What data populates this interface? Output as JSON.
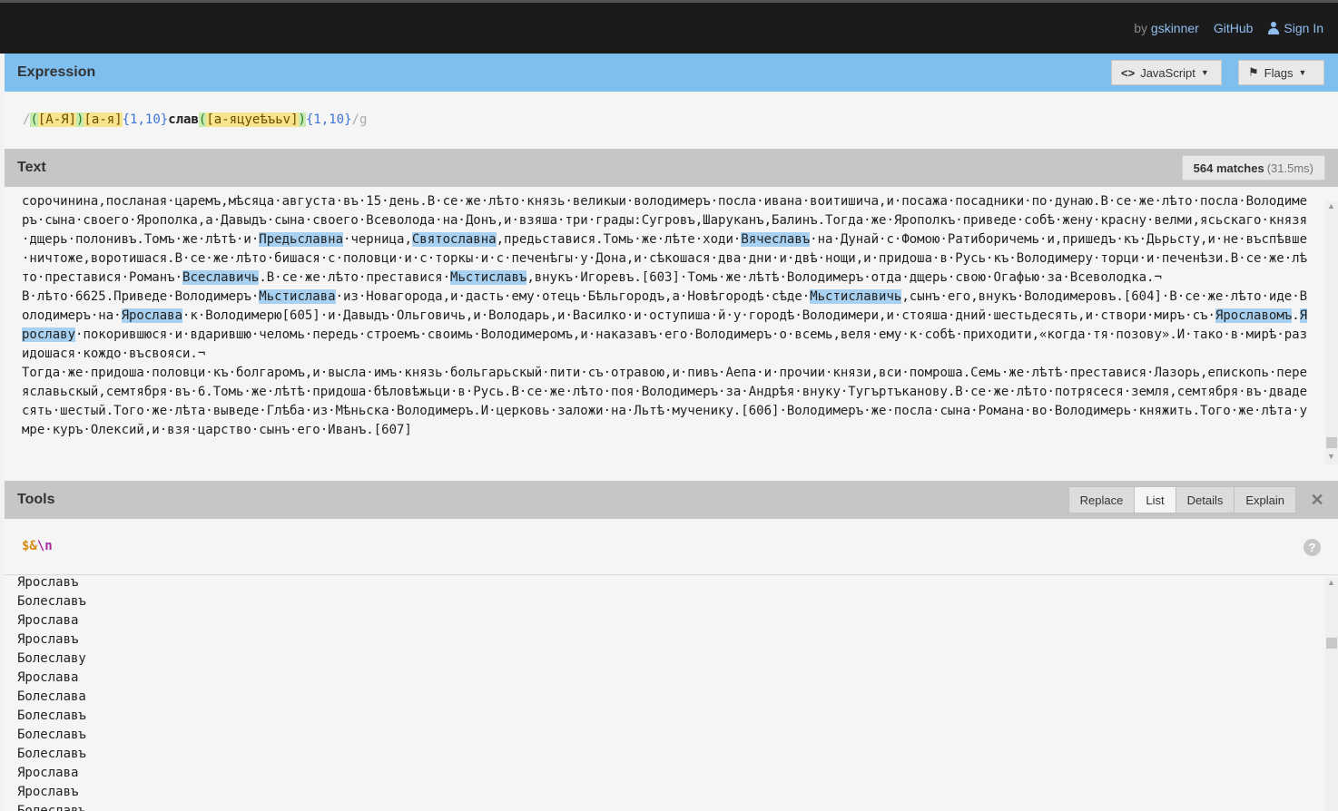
{
  "topbar": {
    "by_prefix": "by",
    "author": "gskinner",
    "github": "GitHub",
    "signin": "Sign In"
  },
  "expression": {
    "header": "Expression",
    "flavor": "JavaScript",
    "flags_label": "Flags",
    "tokens": {
      "open_slash": "/",
      "group_open": "(",
      "set1": "[А-Я]",
      "group_close": ")",
      "set2": "[а-я]",
      "quant1": "{1,10}",
      "literal": "слав",
      "group2_open": "(",
      "set3": "[а-яцуеѣъьv]",
      "group2_close": ")",
      "quant2": "{1,10}",
      "close_slash": "/",
      "flags": "g"
    }
  },
  "text_panel": {
    "header": "Text",
    "match_count": "564 matches",
    "match_time": "(31.5ms)",
    "segments": [
      {
        "t": "сорочинина,посланая·царемъ,мѣсяца·августа·въ·15·день.В·се·же·лѣто·князь·великыи·володимеръ·посла·ивана·воитишича,и·посажа·посадники·по·дунаю.В·се·же·лѣто·посла·Володимеръ·сына·своего·Ярополка,а·Давыдъ·сына·своего·Всеволода·на·Донъ,и·взяша·три·грады:Сугровъ,Шаруканъ,Балинъ.Тогда·же·Ярополкъ·приведе·собѣ·жену·красну·велми,ясьскаго·князя·дщерь·полонивъ.Томъ·же·лѣтѣ·и·"
      },
      {
        "t": "Предьславна",
        "h": true
      },
      {
        "t": "·черница,"
      },
      {
        "t": "Святославна",
        "h": true
      },
      {
        "t": ",предьставися.Томь·же·лѣте·ходи·"
      },
      {
        "t": "Вячеславъ",
        "h": true
      },
      {
        "t": "·на·Дунай·с·Фомою·Ратиборичемь·и,пришедъ·къ·Дьрьсту,и·не·въспѣвше·ничтоже,воротишася.В·се·же·лѣто·бишася·с·половци·и·с·торкы·и·с·печенѣгы·у·Дона,и·сѣкошася·два·дни·и·двѣ·нощи,и·придоша·в·Русь·къ·Володимеру·торци·и·печенѣзи.В·се·же·лѣто·преставися·Романъ·"
      },
      {
        "t": "Всеславичь",
        "h": true
      },
      {
        "t": ".В·се·же·лѣто·преставися·"
      },
      {
        "t": "Мьстиславъ",
        "h": true
      },
      {
        "t": ",внукъ·Игоревъ.[603]·Томь·же·лѣтѣ·Володимеръ·отда·дщерь·свою·Огафью·за·Всеволодка.¬\nВ·лѣто·6625.Приведе·Володимеръ·"
      },
      {
        "t": "Мьстислава",
        "h": true
      },
      {
        "t": "·из·Новагорода,и·дасть·ему·отець·Бѣльгородъ,а·Новѣгородѣ·сѣде·"
      },
      {
        "t": "Мьстиславичь",
        "h": true
      },
      {
        "t": ",сынъ·его,внукъ·Володимеровъ.[604]·В·се·же·лѣто·иде·Володимеръ·на·"
      },
      {
        "t": "Ярослава",
        "h": true
      },
      {
        "t": "·к·Володимерю[605]·и·Давыдъ·Ольговичь,и·Володарь,и·Василко·и·оступиша·й·у·городѣ·Володимери,и·стояша·дний·шестьдесять,и·створи·миръ·съ·"
      },
      {
        "t": "Ярославомъ",
        "h": true
      },
      {
        "t": "."
      },
      {
        "t": "Ярославу",
        "h": true
      },
      {
        "t": "·покорившюся·и·вдарившю·челомь·передь·строемъ·своимь·Володимеромъ,и·наказавъ·его·Володимеръ·о·всемь,веля·ему·к·собѣ·приходити,«когда·тя·позову».И·тако·в·мирѣ·разидошася·кождо·въсвояси.¬\nТогда·же·придоша·половци·къ·болгаромъ,и·высла·имъ·князь·больгарьскый·пити·съ·отравою,и·пивъ·Аепа·и·прочии·князи,вси·помроша.Семь·же·лѣтѣ·преставися·Лазорь,епископь·переяславьскый,семтября·въ·6.Томь·же·лѣтѣ·придоша·бѣловѣжьци·в·Русь.В·се·же·лѣто·поя·Володимеръ·за·Андрѣя·внуку·Тугъртъканову.В·се·же·лѣто·потрясеся·земля,семтября·въ·двадесять·шестый.Того·же·лѣта·выведе·Глѣба·из·Мѣньска·Володимеръ.И·церковь·заложи·на·Льтѣ·мученику.[606]·Володимеръ·же·посла·сына·Романа·во·Володимерь·княжить.Того·же·лѣта·умре·куръ·Олексий,и·взя·царство·сынъ·его·Иванъ.[607]"
      }
    ]
  },
  "tools": {
    "header": "Tools",
    "tabs": [
      "Replace",
      "List",
      "Details",
      "Explain"
    ],
    "active_tab": "List",
    "input": {
      "dollar": "$&",
      "esc": "\\n"
    },
    "help": "?",
    "results": [
      "Ярославъ",
      "Болеславъ",
      "Ярослава",
      "Ярославъ",
      "Болеславу",
      "Ярослава",
      "Болеслава",
      "Болеславъ",
      "Болеславъ",
      "Болеславъ",
      "Ярослава",
      "Ярославъ",
      "Болеславъ"
    ]
  }
}
